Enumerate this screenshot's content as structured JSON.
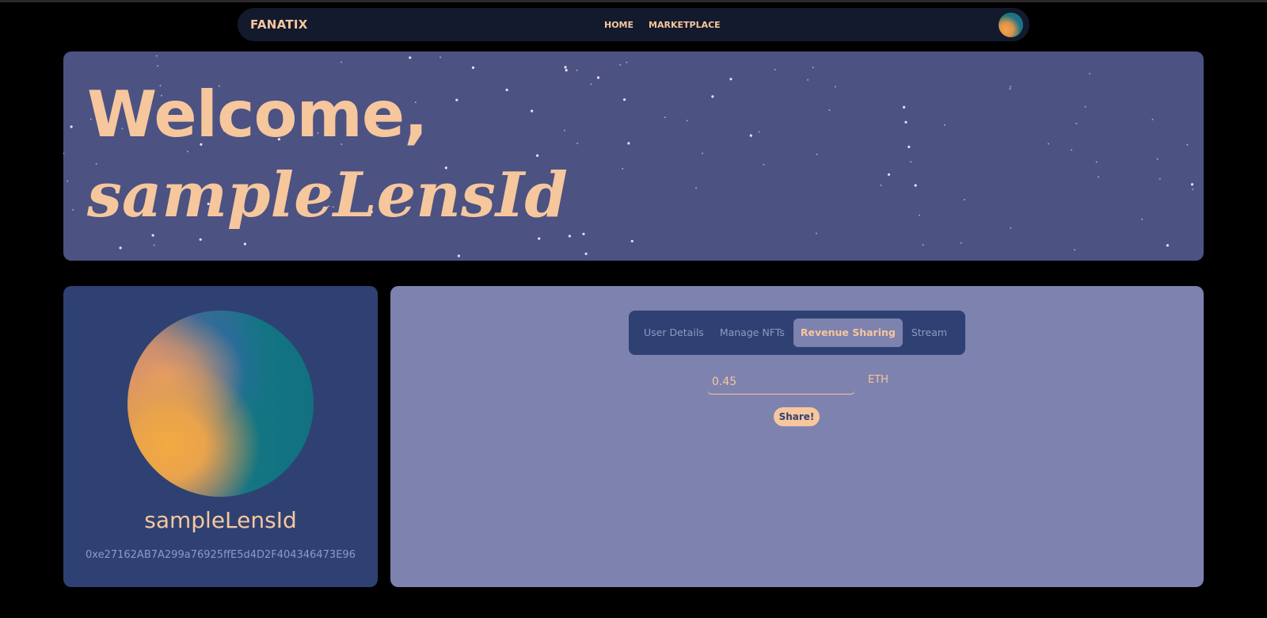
{
  "navbar": {
    "brand": "FANATIX",
    "links": [
      {
        "label": "HOME"
      },
      {
        "label": "MARKETPLACE"
      }
    ]
  },
  "hero": {
    "greeting": "Welcome,",
    "username": "sampleLensId"
  },
  "profile": {
    "name": "sampleLensId",
    "address": "0xe27162AB7A299a76925ffE5d4D2F404346473E96"
  },
  "tabs": [
    {
      "label": "User Details",
      "active": false
    },
    {
      "label": "Manage NFTs",
      "active": false
    },
    {
      "label": "Revenue Sharing",
      "active": true
    },
    {
      "label": "Stream",
      "active": false
    }
  ],
  "revenue_sharing": {
    "amount_value": "0.45",
    "unit": "ETH",
    "share_label": "Share!"
  },
  "colors": {
    "background": "#000000",
    "navbar": "#141a2d",
    "hero": "#4c5282",
    "card": "#2f4172",
    "panel": "#7e82ae",
    "accent": "#f6c79d",
    "muted_text": "#8d9ac4"
  }
}
